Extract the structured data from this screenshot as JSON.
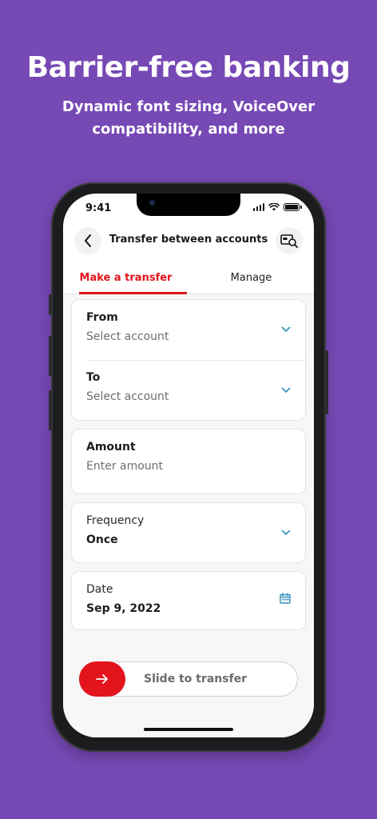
{
  "promo": {
    "headline": "Barrier-free banking",
    "subline": "Dynamic font sizing, VoiceOver compatibility, and more"
  },
  "status_bar": {
    "time": "9:41"
  },
  "nav": {
    "title": "Transfer between accounts",
    "back_icon": "chevron-left-icon",
    "action_icon": "check-search-icon"
  },
  "tabs": [
    {
      "label": "Make a transfer",
      "active": true
    },
    {
      "label": "Manage",
      "active": false
    }
  ],
  "form": {
    "from": {
      "label": "From",
      "placeholder": "Select account"
    },
    "to": {
      "label": "To",
      "placeholder": "Select account"
    },
    "amount": {
      "label": "Amount",
      "placeholder": "Enter amount"
    },
    "frequency": {
      "label": "Frequency",
      "value": "Once"
    },
    "date": {
      "label": "Date",
      "value": "Sep 9, 2022"
    }
  },
  "slider": {
    "label": "Slide to transfer"
  },
  "colors": {
    "background": "#7649b5",
    "accent": "#e3141b",
    "link": "#2f8fbf"
  }
}
